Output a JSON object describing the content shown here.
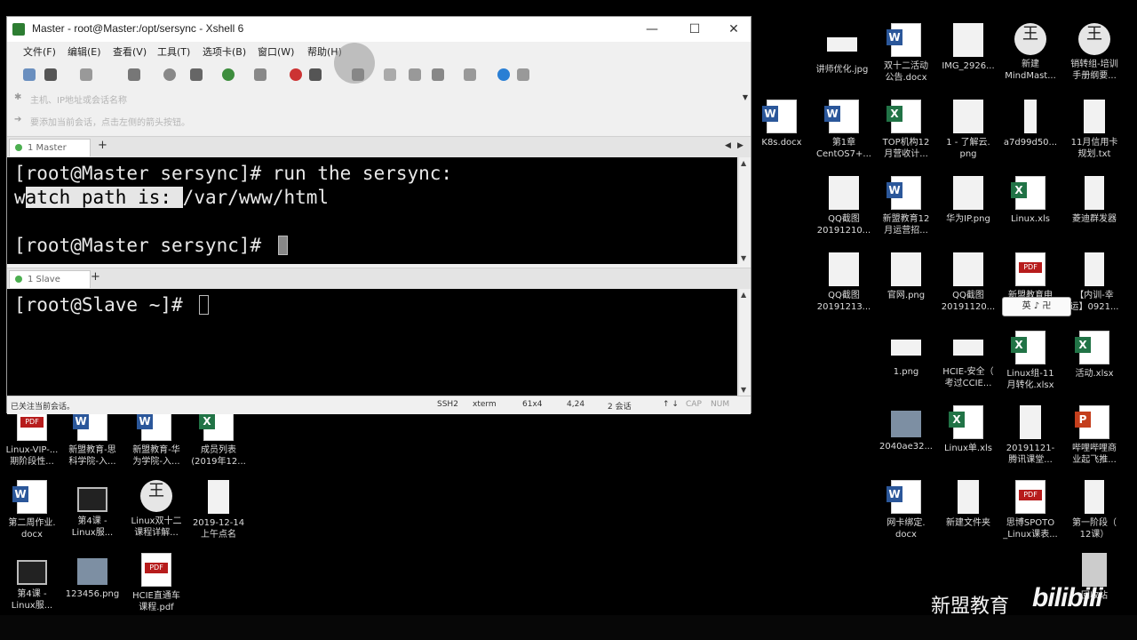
{
  "window": {
    "title": "Master - root@Master:/opt/sersync - Xshell 6",
    "controls": {
      "minimize": "—",
      "maximize": "☐",
      "close": "✕"
    }
  },
  "menu": [
    "文件(F)",
    "编辑(E)",
    "查看(V)",
    "工具(T)",
    "选项卡(B)",
    "窗口(W)",
    "帮助(H)"
  ],
  "address_bar": {
    "text": "主机、IP地址或会话名称"
  },
  "hint_bar": {
    "text": "要添加当前会话，点击左侧的箭头按钮。"
  },
  "sessions": {
    "top_tab": "1 Master",
    "bottom_tab": "1 Slave",
    "add_tab": "+",
    "nav_prev": "◀",
    "nav_next": "▶"
  },
  "terminal_master": {
    "line1": "[root@Master sersync]# run the sersync:",
    "line2_first": "w",
    "line2_selected": "atch path is: ",
    "line2_rest": "/var/www/html",
    "line3": "[root@Master sersync]# "
  },
  "terminal_slave": {
    "line1": "[root@Slave ~]# "
  },
  "status": {
    "left": "已关注当前会话。",
    "ssh": "SSH2",
    "term": "xterm",
    "size": "61x4",
    "pos": "4,24",
    "sessions": "2 会话",
    "cap": "CAP",
    "num": "NUM"
  },
  "desktop_icons": [
    {
      "label1": "讲师优化.jpg",
      "label2": "",
      "type": "blank"
    },
    {
      "label1": "双十二活动",
      "label2": "公告.docx",
      "type": "word"
    },
    {
      "label1": "IMG_2926...",
      "label2": "",
      "type": "blank"
    },
    {
      "label1": "新建",
      "label2": "MindMast...",
      "type": "mind"
    },
    {
      "label1": "销转组-培训",
      "label2": "手册纲要...",
      "type": "mind"
    },
    {
      "label1": "K8s.docx",
      "label2": "",
      "type": "word"
    },
    {
      "label1": "第1章",
      "label2": "CentOS7+...",
      "type": "word"
    },
    {
      "label1": "TOP机构12",
      "label2": "月营收计...",
      "type": "excel"
    },
    {
      "label1": "1 - 了解云.",
      "label2": "png",
      "type": "blank"
    },
    {
      "label1": "a7d99d50...",
      "label2": "",
      "type": "blank"
    },
    {
      "label1": "11月信用卡",
      "label2": "规划.txt",
      "type": "blank"
    },
    {
      "label1": "QQ截图",
      "label2": "20191210...",
      "type": "blank"
    },
    {
      "label1": "新盟教育12",
      "label2": "月运营招...",
      "type": "word"
    },
    {
      "label1": "华为IP.png",
      "label2": "",
      "type": "blank"
    },
    {
      "label1": "Linux.xls",
      "label2": "",
      "type": "excel"
    },
    {
      "label1": "菱迪群发器",
      "label2": "",
      "type": "blank"
    },
    {
      "label1": "QQ截图",
      "label2": "20191213...",
      "type": "blank"
    },
    {
      "label1": "官网.png",
      "label2": "",
      "type": "blank"
    },
    {
      "label1": "QQ截图",
      "label2": "20191120...",
      "type": "blank"
    },
    {
      "label1": "新盟教育申",
      "label2": "",
      "type": "pdf"
    },
    {
      "label1": "【内训-幸",
      "label2": "运】0921...",
      "type": "blank"
    },
    {
      "label1": "1.png",
      "label2": "",
      "type": "blank"
    },
    {
      "label1": "HCIE-安全（",
      "label2": "考过CCIE...",
      "type": "blank"
    },
    {
      "label1": "Linux组-11",
      "label2": "月转化.xlsx",
      "type": "excel"
    },
    {
      "label1": "活动.xlsx",
      "label2": "",
      "type": "excel"
    },
    {
      "label1": "2040ae32...",
      "label2": "",
      "type": "image"
    },
    {
      "label1": "Linux单.xls",
      "label2": "",
      "type": "excel"
    },
    {
      "label1": "20191121-",
      "label2": "腾讯课堂...",
      "type": "blank"
    },
    {
      "label1": "哔哩哔哩商",
      "label2": "业起飞推...",
      "type": "ppt"
    },
    {
      "label1": "网卡绑定.",
      "label2": "docx",
      "type": "word"
    },
    {
      "label1": "新建文件夹",
      "label2": "",
      "type": "folder"
    },
    {
      "label1": "思博SPOTO",
      "label2": "_Linux课表...",
      "type": "pdf"
    },
    {
      "label1": "第一阶段（",
      "label2": "12课）",
      "type": "blank"
    },
    {
      "label1": "Linux-VIP-...",
      "label2": "期阶段性...",
      "type": "pdf"
    },
    {
      "label1": "新盟教育-思",
      "label2": "科学院-入...",
      "type": "word"
    },
    {
      "label1": "新盟教育-华",
      "label2": "为学院-入...",
      "type": "word"
    },
    {
      "label1": "成员列表",
      "label2": "(2019年12...",
      "type": "excel"
    },
    {
      "label1": "第二周作业.",
      "label2": "docx",
      "type": "word"
    },
    {
      "label1": "第4课 -",
      "label2": "Linux服...",
      "type": "video"
    },
    {
      "label1": "Linux双十二",
      "label2": "课程详解...",
      "type": "mind"
    },
    {
      "label1": "2019-12-14",
      "label2": "上午点名",
      "type": "blank"
    },
    {
      "label1": "第4课 -",
      "label2": "Linux服...",
      "type": "video"
    },
    {
      "label1": "123456.png",
      "label2": "",
      "type": "image"
    },
    {
      "label1": "HCIE直通车",
      "label2": "课程.pdf",
      "type": "pdf"
    },
    {
      "label1": "回收站",
      "label2": "",
      "type": "recycle"
    }
  ],
  "ime_popup": "英 ♪ 卍",
  "watermark": {
    "brand": "新盟教育",
    "site": "bilibili"
  }
}
